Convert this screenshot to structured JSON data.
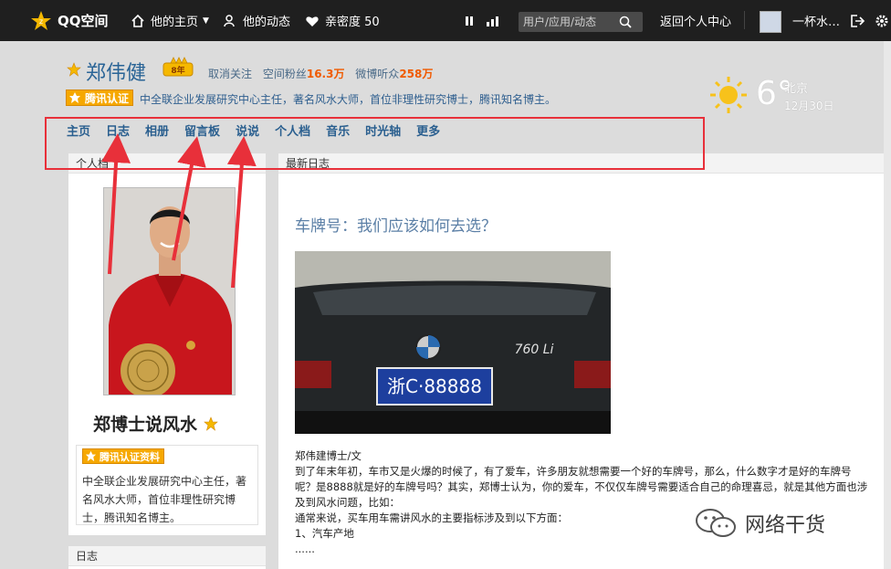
{
  "topbar": {
    "brand": "QQ空间",
    "his_home": "他的主页",
    "his_feed": "他的动态",
    "intimacy": "亲密度 50",
    "search_placeholder": "用户/应用/动态",
    "return_center": "返回个人中心",
    "user_nick": "一杯水…"
  },
  "profile": {
    "name": "郑伟健",
    "year_badge": "8年",
    "unfollow": "取消关注",
    "fans_label": "空间粉丝",
    "fans_value": "16.3万",
    "weibo_label": "微博听众",
    "weibo_value": "258万",
    "cert_label": "腾讯认证",
    "cert_desc": "中全联企业发展研究中心主任，著名风水大师，首位非理性研究博士，腾讯知名博主。"
  },
  "weather": {
    "temp": "6°",
    "city": "北京",
    "date": "12月30日"
  },
  "nav": [
    "主页",
    "日志",
    "相册",
    "留言板",
    "说说",
    "个人档",
    "音乐",
    "时光轴",
    "更多"
  ],
  "left": {
    "panel_title": "个人档",
    "space_name": "郑博士说风水",
    "info_badge": "腾讯认证资料",
    "info_text": "中全联企业发展研究中心主任，著名风水大师，首位非理性研究博士，腾讯知名博主。",
    "panel2_title": "日志"
  },
  "right": {
    "panel_title": "最新日志",
    "article_title": "车牌号：我们应该如何去选？",
    "plate_text": "浙C·88888",
    "car_model": "760 Li",
    "body": [
      "郑伟建博士/文",
      "到了年末年初，车市又是火爆的时候了，有了爱车，许多朋友就想需要一个好的车牌号，那么，什么数字才是好的车牌号呢？是8888就是好的车牌号吗？其实，郑博士认为，你的爱车，不仅仅车牌号需要适合自己的命理喜忌，就是其他方面也涉及到风水问题，比如：",
      "通常来说，买车用车需讲风水的主要指标涉及到以下方面：",
      "1、汽车产地",
      "......"
    ]
  },
  "watermark": "网络干货",
  "colors": {
    "accent_orange": "#f05a00",
    "link_blue": "#2a5f8f",
    "annotation_red": "#e8303a"
  }
}
